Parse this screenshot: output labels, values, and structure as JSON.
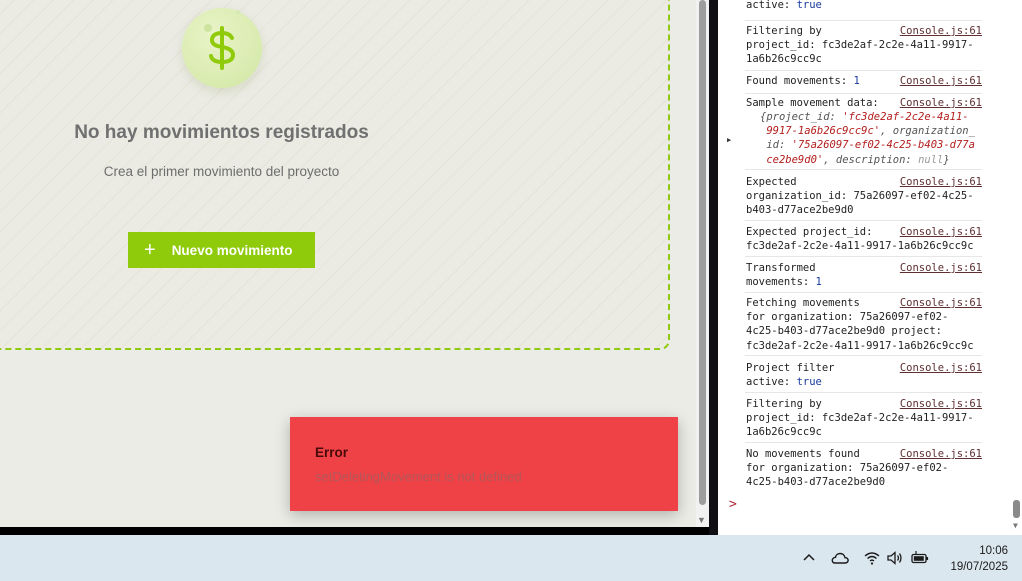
{
  "app": {
    "empty_title": "No hay movimientos registrados",
    "empty_subtitle": "Crea el primer movimiento del proyecto",
    "new_button_label": "Nuevo movimiento",
    "icon": "dollar-icon"
  },
  "toast": {
    "title": "Error",
    "message": "setDeletingMovement is not defined"
  },
  "console": {
    "source": "Console.js:61",
    "top_partial": "active:",
    "top_partial_value": "true",
    "entries": {
      "e1": "Filtering by\nproject_id: fc3de2af-2c2e-4a11-9917-\n1a6b26c9cc9c",
      "e2_label": "Found movements:",
      "e2_value": "1",
      "e3": "Sample movement data:",
      "e3_obj_l1_key": "{project_id: ",
      "e3_obj_l1_val": "'fc3de2af-2c2e-4a11-",
      "e3_obj_l2_val": "9917-1a6b26c9cc9c'",
      "e3_obj_l2_key": ", organization_",
      "e3_obj_l3_key": "id: ",
      "e3_obj_l3_val": "'75a26097-ef02-4c25-b403-d77a",
      "e3_obj_l4_val": "ce2be9d0'",
      "e3_obj_l4_rest": ", description: ",
      "e3_obj_l4_null": "null",
      "e3_obj_l4_end": "}",
      "e4": "Expected\norganization_id: 75a26097-ef02-4c25-\nb403-d77ace2be9d0",
      "e5": "Expected project_id:\nfc3de2af-2c2e-4a11-9917-1a6b26c9cc9c",
      "e6_label": "Transformed\nmovements:",
      "e6_value": "1",
      "e7": "Fetching movements\nfor organization: 75a26097-ef02-\n4c25-b403-d77ace2be9d0 project:\nfc3de2af-2c2e-4a11-9917-1a6b26c9cc9c",
      "e8_label": "Project filter\nactive:",
      "e8_value": "true",
      "e9": "Filtering by\nproject_id: fc3de2af-2c2e-4a11-9917-\n1a6b26c9cc9c",
      "e10": "No movements found\nfor organization: 75a26097-ef02-\n4c25-b403-d77ace2be9d0"
    },
    "prompt": ">"
  },
  "taskbar": {
    "time": "10:06",
    "date": "19/07/2025",
    "icons": [
      "chevron-up-icon",
      "cloud-icon",
      "wifi-icon",
      "volume-icon",
      "battery-icon"
    ]
  },
  "colors": {
    "accent": "#8fca0b",
    "toast_bg": "#ef4246",
    "console_link": "#5f2f32"
  }
}
